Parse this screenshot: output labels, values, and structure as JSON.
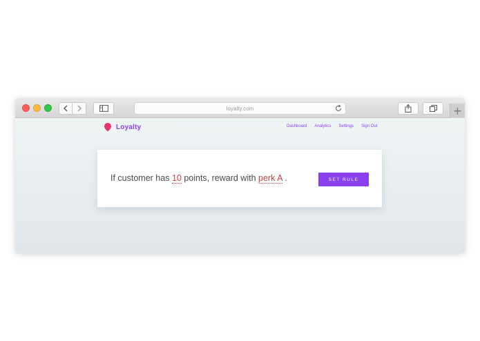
{
  "browser": {
    "url": "loyalty.com",
    "new_tab_label": "+"
  },
  "app": {
    "brand_name": "Loyalty",
    "nav_items": [
      "Dashboard",
      "Analytics",
      "Settings",
      "Sign Out"
    ]
  },
  "rule": {
    "prefix": "If customer has ",
    "points_value": "10",
    "middle": " points, reward with ",
    "perk_value": "perk A",
    "suffix": " .",
    "button_label": "SET RULE"
  },
  "colors": {
    "accent": "#8a3ff0",
    "editable_text": "#c0424a",
    "logo": "#e8336d"
  },
  "icons": [
    "back-chevron-icon",
    "forward-chevron-icon",
    "sidebar-icon",
    "reload-icon",
    "share-icon",
    "tabs-icon"
  ]
}
